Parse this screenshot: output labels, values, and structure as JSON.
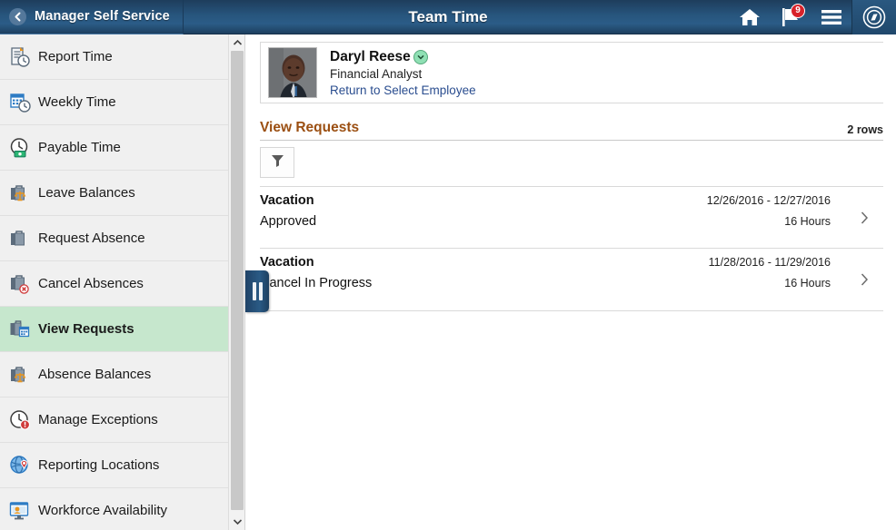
{
  "header": {
    "back_label": "Manager Self Service",
    "back_icon": "chevron-left-icon",
    "title": "Team Time",
    "icons": [
      {
        "name": "home-icon",
        "label": "Home"
      },
      {
        "name": "notifications-flag-icon",
        "label": "Notifications",
        "badge": "9"
      },
      {
        "name": "actions-menu-icon",
        "label": "Actions Menu"
      },
      {
        "name": "nav-bar-compass-icon",
        "label": "NavBar"
      }
    ],
    "colors": {
      "bar_dark": "#1e3d5c",
      "bar_light": "#2b5c87",
      "badge": "#d8222a"
    }
  },
  "sidebar": {
    "scroll_up_icon": "chevron-up-icon",
    "scroll_down_icon": "chevron-down-icon",
    "active_index": 6,
    "active_color": "#c6e7cd",
    "items": [
      {
        "label": "Report Time",
        "icon": "report-time-icon"
      },
      {
        "label": "Weekly Time",
        "icon": "weekly-time-calendar-icon"
      },
      {
        "label": "Payable Time",
        "icon": "payable-time-clock-icon"
      },
      {
        "label": "Leave Balances",
        "icon": "leave-balances-briefcase-icon"
      },
      {
        "label": "Request Absence",
        "icon": "request-absence-briefcase-icon"
      },
      {
        "label": "Cancel Absences",
        "icon": "cancel-absences-briefcase-icon"
      },
      {
        "label": "View Requests",
        "icon": "view-requests-briefcase-calendar-icon"
      },
      {
        "label": "Absence Balances",
        "icon": "absence-balances-scale-icon"
      },
      {
        "label": "Manage Exceptions",
        "icon": "manage-exceptions-clock-alert-icon"
      },
      {
        "label": "Reporting Locations",
        "icon": "reporting-locations-globe-pin-icon"
      },
      {
        "label": "Workforce Availability",
        "icon": "workforce-availability-monitor-icon"
      }
    ]
  },
  "splitter": {
    "name": "collapse-sidebar-handle",
    "icon": "pause-bars-icon"
  },
  "employee": {
    "photo_alt": "employee-photo",
    "name": "Daryl Reese",
    "related_actions_icon": "related-actions-chevron-icon",
    "job_title": "Financial Analyst",
    "return_link": "Return to Select Employee"
  },
  "main": {
    "section_title": "View Requests",
    "row_count_label": "2 rows",
    "filter_icon": "filter-funnel-icon",
    "row_chevron_icon": "chevron-right-icon",
    "requests": [
      {
        "type": "Vacation",
        "status": "Approved",
        "dates": "12/26/2016 - 12/27/2016",
        "hours": "16 Hours"
      },
      {
        "type": "Vacation",
        "status": "Cancel In Progress",
        "dates": "11/28/2016 - 11/29/2016",
        "hours": "16 Hours"
      }
    ]
  }
}
